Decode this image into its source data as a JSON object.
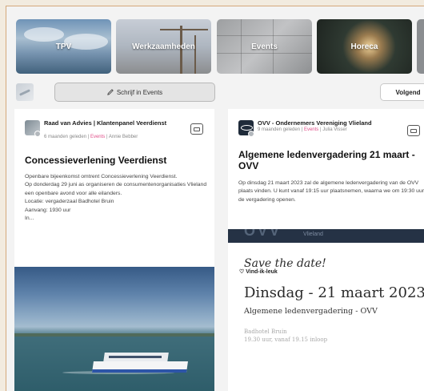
{
  "categories": [
    {
      "label": "TPV"
    },
    {
      "label": "Werkzaamheden"
    },
    {
      "label": "Events"
    },
    {
      "label": "Horeca"
    },
    {
      "label": ""
    }
  ],
  "toolbar": {
    "write_label": "Schrijf in Events",
    "follow_label": "Volgend"
  },
  "posts": [
    {
      "author": "Raad van Advies | Klantenpanel Veerdienst",
      "time": "6 maanden geleden",
      "category": "Events",
      "user": "Annie Bebber",
      "title": "Concessieverlening Veerdienst",
      "body": [
        "Openbare bijeenkomst omtrent Concessieverlening Veerdienst.",
        "Op donderdag 29 juni as organiseren de consumentenorganisaties Vlieland een openbare avond voor alle eilanders.",
        "Locatie: vergaderzaal Badhotel Bruin",
        "Aanvang: 1930 uur",
        "In..."
      ]
    },
    {
      "author": "OVV - Ondernemers Vereniging Vlieland",
      "time": "9 maanden geleden",
      "category": "Events",
      "user": "Julia Visser",
      "title": "Algemene ledenvergadering 21 maart - OVV",
      "body": [
        "Op dinsdag 21 maart 2023 zal de algemene ledenvergadering van de OVV plaats vinden. U kunt vanaf 19:15 uur plaatsnemen, waarna we om 19:30 uur de vergadering openen."
      ],
      "banner": {
        "brand": "OVV",
        "place": "Vlieland",
        "save": "Save the date!",
        "date": "Dinsdag - 21 maart 2023",
        "subtitle": "Algemene ledenvergadering - OVV",
        "location": "Badhotel Bruin",
        "time": "19.30 uur, vanaf 19.15 inloop"
      },
      "like_label": "Vind-ik-leuk"
    }
  ],
  "separator": "|"
}
